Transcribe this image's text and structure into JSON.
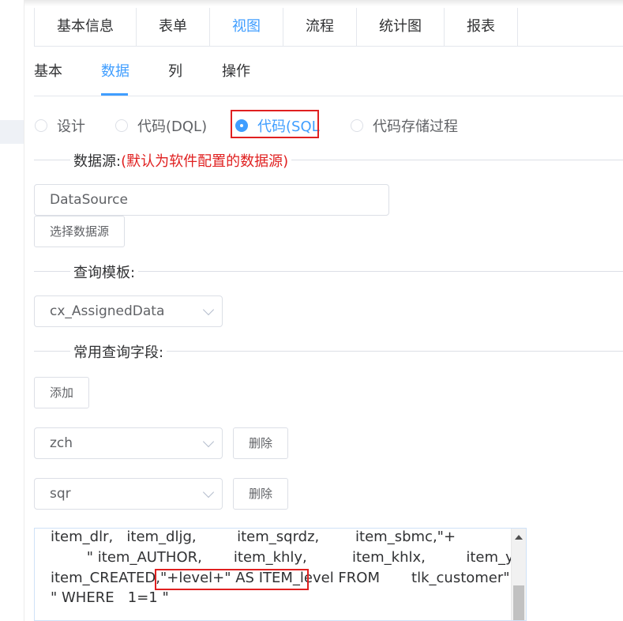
{
  "top_tabs": [
    "基本信息",
    "表单",
    "视图",
    "流程",
    "统计图",
    "报表"
  ],
  "top_tab_active": "视图",
  "sub_tabs": [
    "基本",
    "数据",
    "列",
    "操作"
  ],
  "sub_tab_active": "数据",
  "radios": [
    "设计",
    "代码(DQL)",
    "代码(SQL",
    "代码存储过程"
  ],
  "radio_selected": "代码(SQL",
  "datasource": {
    "label": "数据源:",
    "note": "(默认为软件配置的数据源)",
    "value": "DataSource",
    "select_button": "选择数据源"
  },
  "query_template": {
    "label": "查询模板:",
    "value": "cx_AssignedData"
  },
  "common_fields": {
    "label": "常用查询字段:",
    "add_button": "添加",
    "rows": [
      {
        "value": "zch",
        "delete_label": "删除"
      },
      {
        "value": "sqr",
        "delete_label": "删除"
      }
    ]
  },
  "code_lines": [
    "item_dlr,   item_dljg,         item_sqrdz,        item_sbmc,\"+",
    "        \" item_AUTHOR,       item_khly,          item_khlx,         item_ywmc,",
    "item_CREATED,\"+level+\" AS ITEM_level FROM       tlk_customer\"+",
    "\" WHERE   1=1 \""
  ],
  "colors": {
    "accent": "#409eff",
    "highlight_border": "#e02020",
    "note_text": "#e02020"
  }
}
